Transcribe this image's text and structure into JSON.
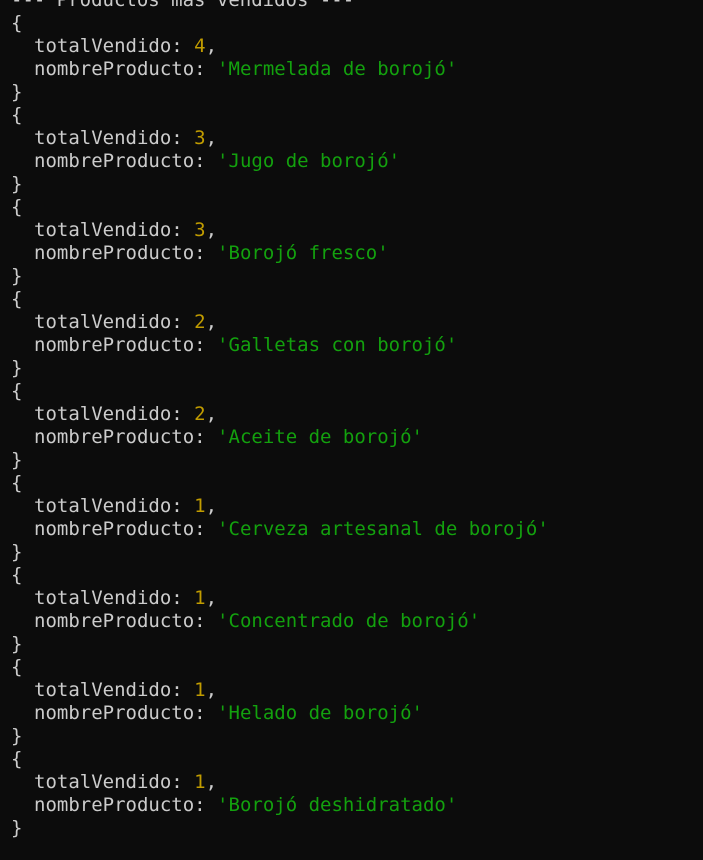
{
  "terminal": {
    "header": "--- Productos más vendidos ---",
    "open_brace": "{",
    "close_brace": "}",
    "key_total": "totalVendido",
    "key_nombre": "nombreProducto",
    "colon": ": ",
    "comma": ",",
    "quote": "'",
    "colors": {
      "background": "#0c0c0c",
      "foreground": "#cccccc",
      "number": "#c19c00",
      "string": "#13a10e"
    },
    "records": [
      {
        "totalVendido": "4",
        "nombreProducto": "Mermelada de borojó"
      },
      {
        "totalVendido": "3",
        "nombreProducto": "Jugo de borojó"
      },
      {
        "totalVendido": "3",
        "nombreProducto": "Borojó fresco"
      },
      {
        "totalVendido": "2",
        "nombreProducto": "Galletas con borojó"
      },
      {
        "totalVendido": "2",
        "nombreProducto": "Aceite de borojó"
      },
      {
        "totalVendido": "1",
        "nombreProducto": "Cerveza artesanal de borojó"
      },
      {
        "totalVendido": "1",
        "nombreProducto": "Concentrado de borojó"
      },
      {
        "totalVendido": "1",
        "nombreProducto": "Helado de borojó"
      },
      {
        "totalVendido": "1",
        "nombreProducto": "Borojó deshidratado"
      }
    ]
  }
}
